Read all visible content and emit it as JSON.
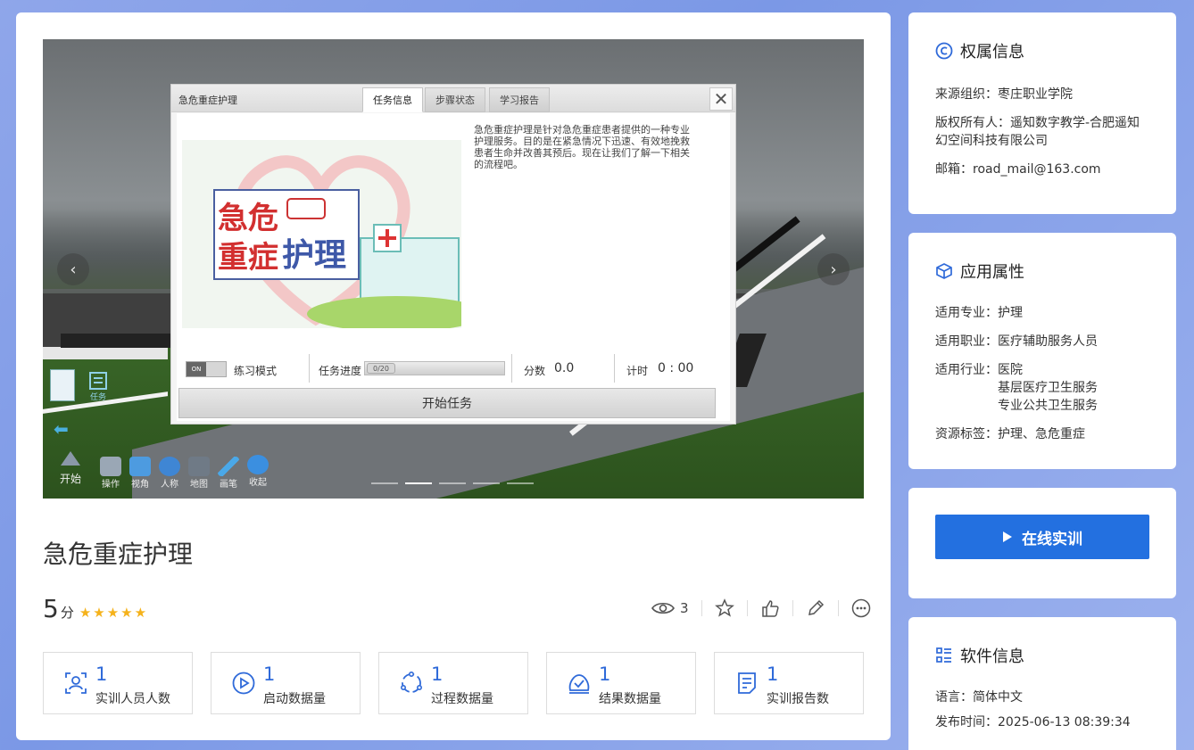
{
  "main": {
    "title": "急危重症护理",
    "score": "5",
    "score_unit": "分",
    "stars": "★★★★★",
    "views": "3"
  },
  "scene": {
    "prev_arrow": "‹",
    "next_arrow": "›",
    "dialog": {
      "title": "急危重症护理",
      "tabs": [
        "任务信息",
        "步骤状态",
        "学习报告"
      ],
      "close": "✕",
      "description": "急危重症护理是针对急危重症患者提供的一种专业护理服务。目的是在紧急情况下迅速、有效地挽救患者生命并改善其预后。现在让我们了解一下相关的流程吧。",
      "image_text_1": "急危",
      "image_text_2": "重症",
      "image_text_3": "护理",
      "toggle_label": "ON",
      "practice_mode": "练习模式",
      "task_progress": "任务进度",
      "progress_value": "0/20",
      "score_label": "分数",
      "score_value": "0.0",
      "time_label": "计时",
      "time_value": "0 : 00",
      "start_button": "开始任务"
    },
    "side_tools": {
      "task_label": "任务",
      "start_label": "开始"
    },
    "toolbar": [
      "操作",
      "视角",
      "人称",
      "地图",
      "画笔",
      "收起"
    ]
  },
  "stats": [
    {
      "value": "1",
      "label": "实训人员人数",
      "icon": "users-icon"
    },
    {
      "value": "1",
      "label": "启动数据量",
      "icon": "play-icon"
    },
    {
      "value": "1",
      "label": "过程数据量",
      "icon": "process-icon"
    },
    {
      "value": "1",
      "label": "结果数据量",
      "icon": "result-icon"
    },
    {
      "value": "1",
      "label": "实训报告数",
      "icon": "report-icon"
    }
  ],
  "ownership": {
    "title": "权属信息",
    "org_label": "来源组织：",
    "org": "枣庄职业学院",
    "owner_label": "版权所有人：",
    "owner": "遥知数字教学-合肥遥知幻空间科技有限公司",
    "email_label": "邮箱：",
    "email": "road_mail@163.com"
  },
  "app_props": {
    "title": "应用属性",
    "major_label": "适用专业：",
    "major": "护理",
    "job_label": "适用职业：",
    "job": "医疗辅助服务人员",
    "industry_label": "适用行业：",
    "industries": [
      "医院",
      "基层医疗卫生服务",
      "专业公共卫生服务"
    ],
    "tags_label": "资源标签：",
    "tags": "护理、急危重症"
  },
  "online": {
    "button": "在线实训"
  },
  "software": {
    "title": "软件信息",
    "lang_label": "语言：",
    "lang": "简体中文",
    "time_label": "发布时间：",
    "time": "2025-06-13 08:39:34"
  },
  "colors": {
    "accent": "#2370e0",
    "stat_number": "#2f6ad9",
    "star": "#f5b21b"
  }
}
